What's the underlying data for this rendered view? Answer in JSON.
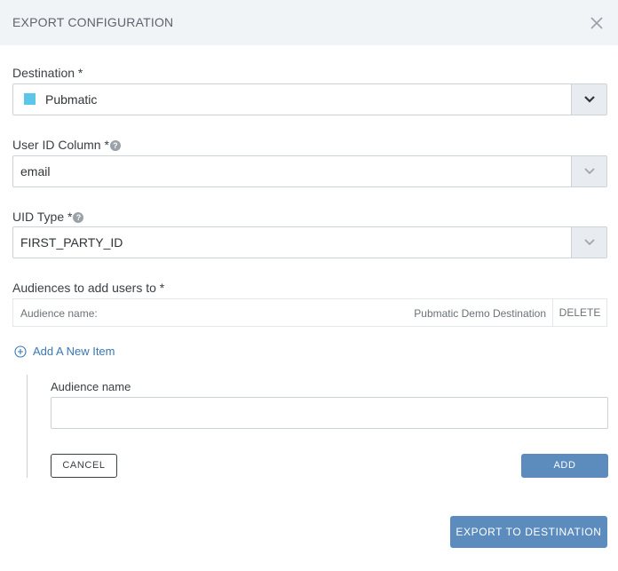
{
  "dialog": {
    "title": "EXPORT CONFIGURATION",
    "close_icon": "close-icon"
  },
  "destination": {
    "label": "Destination *",
    "value": "Pubmatic",
    "swatch_color": "#5bc6e8"
  },
  "user_id_column": {
    "label": "User ID Column *",
    "value": "email"
  },
  "uid_type": {
    "label": "UID Type *",
    "value": "FIRST_PARTY_ID"
  },
  "audiences": {
    "label": "Audiences to add users to *",
    "items": [
      {
        "name_label": "Audience name:",
        "name_value": "Pubmatic Demo Destination",
        "delete_label": "DELETE"
      }
    ],
    "add_item_label": "Add A New Item",
    "new_item": {
      "name_label": "Audience name",
      "name_value": "",
      "cancel_label": "CANCEL",
      "add_label": "ADD"
    }
  },
  "actions": {
    "export_label": "EXPORT TO DESTINATION"
  },
  "colors": {
    "accent": "#5b8cbd",
    "link": "#3b77b3",
    "header_bg": "#f1f4f7"
  }
}
